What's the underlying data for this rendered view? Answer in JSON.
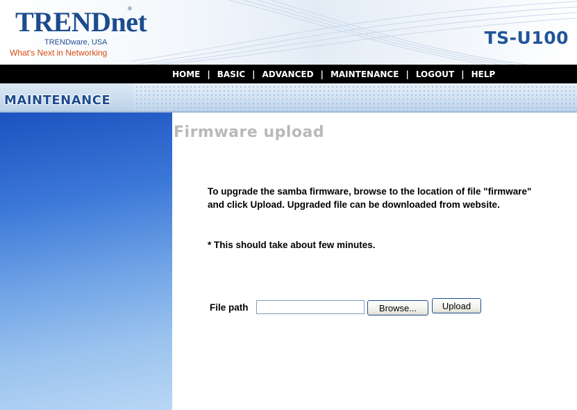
{
  "header": {
    "brand": "TRENDnet",
    "registered": "®",
    "sub": "TRENDware, USA",
    "tagline": "What's Next in Networking",
    "model": "TS-U100"
  },
  "nav": {
    "items": [
      {
        "label": "HOME"
      },
      {
        "label": "BASIC"
      },
      {
        "label": "ADVANCED"
      },
      {
        "label": "MAINTENANCE"
      },
      {
        "label": "LOGOUT"
      },
      {
        "label": "HELP"
      }
    ],
    "separator": "|"
  },
  "section": {
    "title": "MAINTENANCE"
  },
  "main": {
    "page_title": "Firmware upload",
    "description": "To upgrade the samba firmware, browse to the location of file \"firmware\" and click Upload. Upgraded file can be downloaded from website.",
    "note": "* This should take about few minutes.",
    "file_path_label": "File path",
    "file_path_value": "",
    "browse_label": "Browse...",
    "upload_label": "Upload"
  },
  "colors": {
    "brand_blue": "#1c4c8f",
    "tagline_orange": "#d64a12",
    "nav_bg": "#000000",
    "title_gray": "#b9b9b9"
  }
}
